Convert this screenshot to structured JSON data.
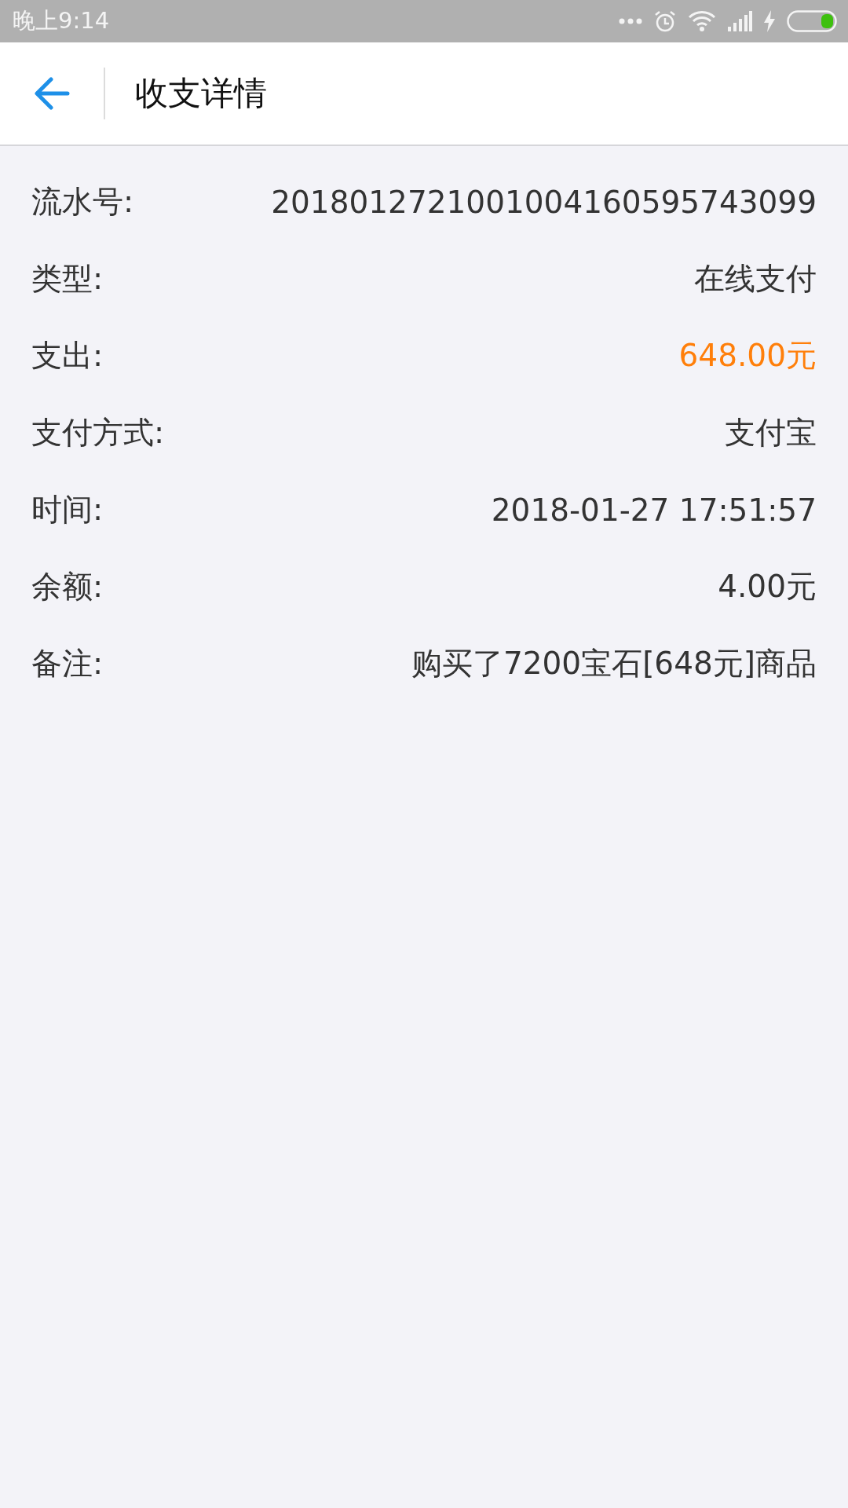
{
  "status_bar": {
    "time": "晚上9:14"
  },
  "header": {
    "title": "收支详情"
  },
  "details": [
    {
      "label": "流水号:",
      "value": "2018012721001004160595743099",
      "color": "#333333"
    },
    {
      "label": "类型:",
      "value": "在线支付",
      "color": "#333333"
    },
    {
      "label": "支出:",
      "value": "648.00元",
      "color": "#ff7f0a"
    },
    {
      "label": "支付方式:",
      "value": "支付宝",
      "color": "#333333"
    },
    {
      "label": "时间:",
      "value": "2018-01-27 17:51:57",
      "color": "#333333"
    },
    {
      "label": "余额:",
      "value": "4.00元",
      "color": "#333333"
    },
    {
      "label": "备注:",
      "value": "购买了7200宝石[648元]商品",
      "color": "#333333"
    }
  ]
}
